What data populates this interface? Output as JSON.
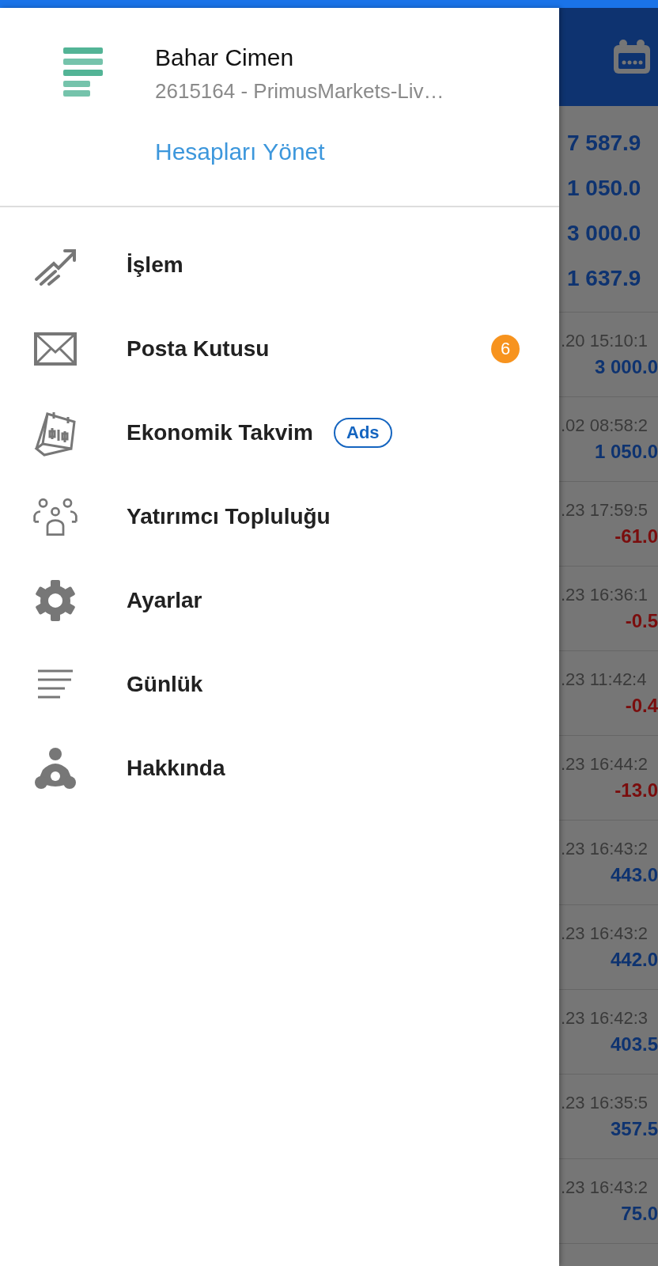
{
  "drawer": {
    "account": {
      "name": "Bahar Cimen",
      "number": "2615164 - PrimusMarkets-Liv…",
      "manage_link": "Hesapları Yönet"
    },
    "items": [
      {
        "label": "İşlem"
      },
      {
        "label": "Posta Kutusu",
        "badge": "6"
      },
      {
        "label": "Ekonomik Takvim",
        "tag": "Ads"
      },
      {
        "label": "Yatırımcı Topluluğu"
      },
      {
        "label": "Ayarlar"
      },
      {
        "label": "Günlük"
      },
      {
        "label": "Hakkında"
      }
    ]
  },
  "background": {
    "summary": [
      "7 587.9",
      "1 050.0",
      "3 000.0",
      "1 637.9"
    ],
    "rows": [
      {
        "time": ".20 15:10:1",
        "value": "3 000.0",
        "negative": false
      },
      {
        "time": ".02 08:58:2",
        "value": "1 050.0",
        "negative": false
      },
      {
        "time": ".23 17:59:5",
        "value": "-61.0",
        "negative": true
      },
      {
        "time": ".23 16:36:1",
        "value": "-0.5",
        "negative": true
      },
      {
        "time": ".23 11:42:4",
        "value": "-0.4",
        "negative": true
      },
      {
        "time": ".23 16:44:2",
        "value": "-13.0",
        "negative": true
      },
      {
        "time": ".23 16:43:2",
        "value": "443.0",
        "negative": false
      },
      {
        "time": ".23 16:43:2",
        "value": "442.0",
        "negative": false
      },
      {
        "time": ".23 16:42:3",
        "value": "403.5",
        "negative": false
      },
      {
        "time": ".23 16:35:5",
        "value": "357.5",
        "negative": false
      },
      {
        "time": ".23 16:43:2",
        "value": "75.0",
        "negative": false
      }
    ]
  }
}
